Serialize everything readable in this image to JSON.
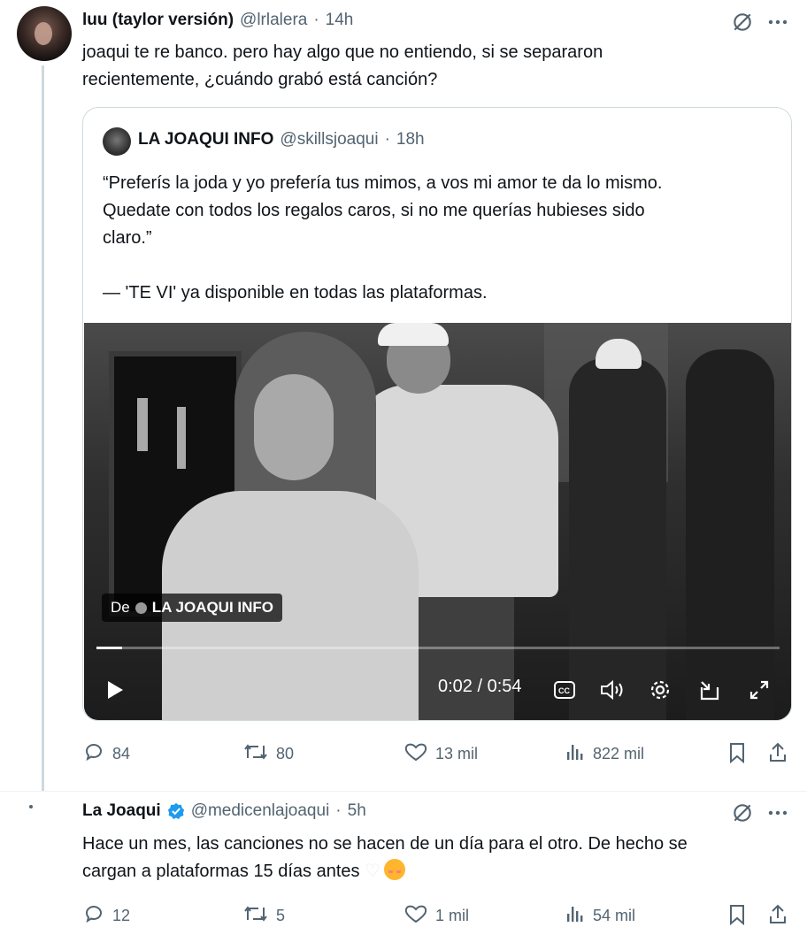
{
  "tweet1": {
    "display_name": "luu (taylor versión)",
    "handle": "@lrlalera",
    "separator": "·",
    "time": "14h",
    "text_line1": "joaqui te re banco. pero hay algo que no entiendo, si se separaron",
    "text_line2": "recientemente, ¿cuándo grabó está canción?",
    "quote": {
      "display_name": "LA JOAQUI INFO",
      "handle": "@skillsjoaqui",
      "separator": "·",
      "time": "18h",
      "line1": "“Preferís la joda y yo prefería tus mimos, a vos mi amor te da lo mismo.",
      "line2": "Quedate con todos los regalos caros, si no me querías hubieses sido",
      "line3": "claro.”",
      "line5": "— 'TE VI' ya disponible en todas las plataformas.",
      "video": {
        "from_prefix": "De",
        "from_name": "LA JOAQUI INFO",
        "time_display": "0:02 / 0:54",
        "progress_fraction": 0.037
      }
    },
    "actions": {
      "replies": "84",
      "retweets": "80",
      "likes": "13 mil",
      "views": "822 mil"
    }
  },
  "tweet2": {
    "display_name": "La Joaqui",
    "handle": "@medicenlajoaqui",
    "separator": "·",
    "time": "5h",
    "text_line1": "Hace un mes, las canciones no se hacen de un día para el otro.  De hecho se",
    "text_line2": "cargan a plataformas 15 días antes",
    "actions": {
      "replies": "12",
      "retweets": "5",
      "likes": "1 mil",
      "views": "54 mil"
    }
  },
  "icons": {
    "grok": "grok-icon",
    "more": "more-icon",
    "reply": "reply-icon",
    "retweet": "retweet-icon",
    "like": "heart-icon",
    "views": "views-icon",
    "bookmark": "bookmark-icon",
    "share": "share-icon",
    "verified": "verified-badge-icon"
  },
  "colors": {
    "text": "#0f1419",
    "secondary": "#536471",
    "border": "#cfd9de",
    "verified": "#1d9bf0"
  }
}
